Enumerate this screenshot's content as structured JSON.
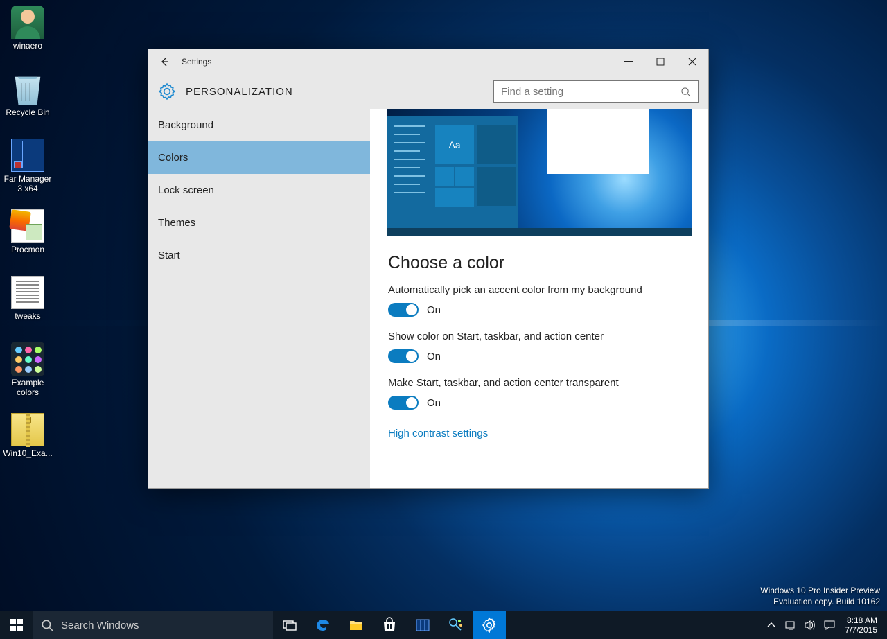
{
  "desktop_icons": [
    {
      "name": "winaero",
      "label": "winaero",
      "icon": "head"
    },
    {
      "name": "recycle-bin",
      "label": "Recycle Bin",
      "icon": "bin"
    },
    {
      "name": "far-manager",
      "label": "Far Manager 3 x64",
      "icon": "far"
    },
    {
      "name": "procmon",
      "label": "Procmon",
      "icon": "proc"
    },
    {
      "name": "tweaks",
      "label": "tweaks",
      "icon": "txt"
    },
    {
      "name": "example-colors",
      "label": "Example colors",
      "icon": "theme"
    },
    {
      "name": "win10-exa",
      "label": "Win10_Exa...",
      "icon": "zip"
    }
  ],
  "watermark": {
    "line1": "Windows 10 Pro Insider Preview",
    "line2": "Evaluation copy. Build 10162"
  },
  "taskbar": {
    "search_placeholder": "Search Windows",
    "tray": {
      "time": "8:18 AM",
      "date": "7/7/2015"
    }
  },
  "window": {
    "title": "Settings",
    "category": "PERSONALIZATION",
    "search_placeholder": "Find a setting",
    "sidebar": [
      {
        "label": "Background",
        "selected": false
      },
      {
        "label": "Colors",
        "selected": true
      },
      {
        "label": "Lock screen",
        "selected": false
      },
      {
        "label": "Themes",
        "selected": false
      },
      {
        "label": "Start",
        "selected": false
      }
    ],
    "content": {
      "heading": "Choose a color",
      "preview_sample": "Aa",
      "settings": [
        {
          "label": "Automatically pick an accent color from my background",
          "state": "On"
        },
        {
          "label": "Show color on Start, taskbar, and action center",
          "state": "On"
        },
        {
          "label": "Make Start, taskbar, and action center transparent",
          "state": "On"
        }
      ],
      "link": "High contrast settings"
    }
  }
}
